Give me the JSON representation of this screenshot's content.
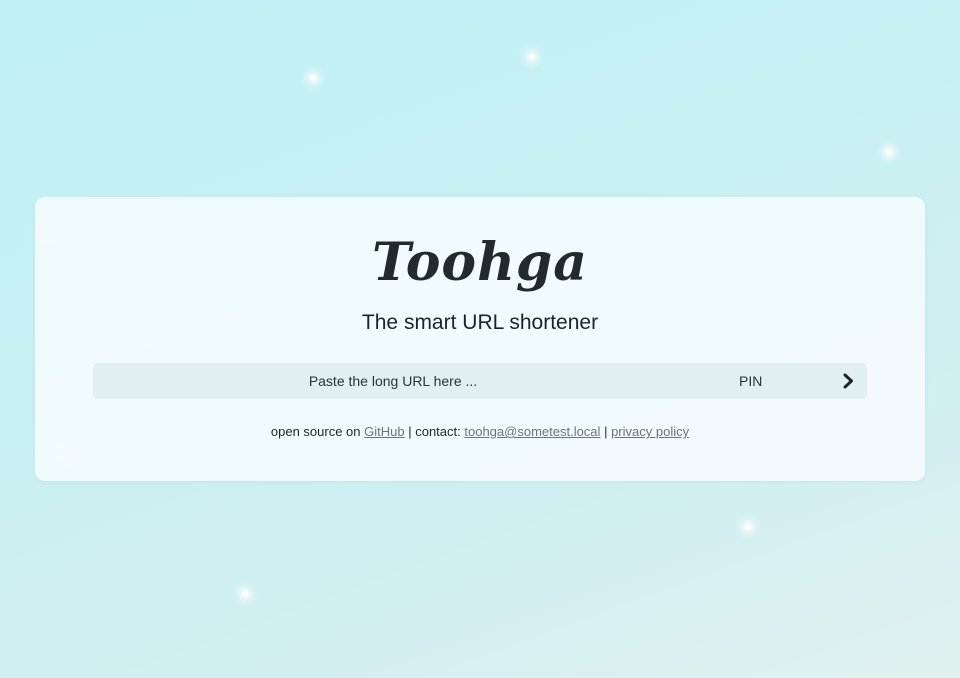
{
  "app": {
    "logo_text": "Toohga",
    "tagline": "The smart URL shortener"
  },
  "shortener_form": {
    "url_placeholder": "Paste the long URL here ...",
    "pin_placeholder": "PIN",
    "submit_icon": "chevron-right-icon"
  },
  "footer": {
    "prefix": "open source on",
    "github_link": "GitHub",
    "separator_1": "| contact:",
    "contact_email": "toohga@sometest.local",
    "separator_2": "|",
    "privacy_link": "privacy policy"
  },
  "colors": {
    "background": "#c4f1f4",
    "card": "#f6fcfe",
    "input_background": "#e1eff1",
    "text": "#222a2b",
    "link": "#6b7476"
  }
}
